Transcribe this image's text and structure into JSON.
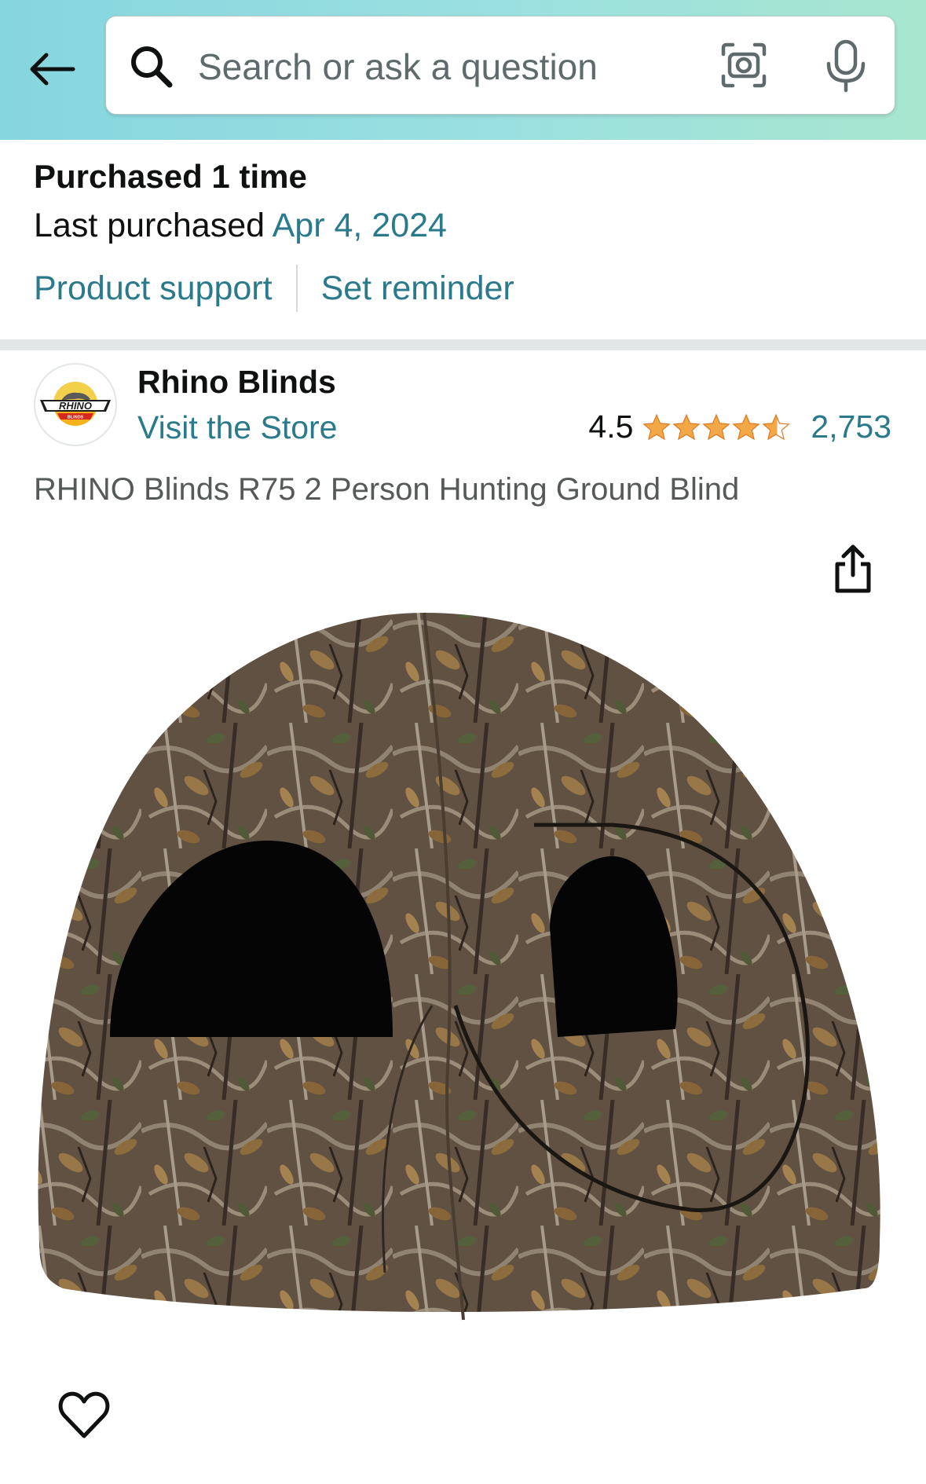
{
  "header": {
    "search_placeholder": "Search or ask a question",
    "colors": {
      "gradient_start": "#86d6df",
      "gradient_end": "#a8e6cf"
    },
    "icons": [
      "back-arrow-icon",
      "search-icon",
      "camera-icon",
      "mic-icon"
    ]
  },
  "purchase": {
    "title": "Purchased 1 time",
    "last_label": "Last purchased",
    "last_date": "Apr 4, 2024",
    "product_support": "Product support",
    "set_reminder": "Set reminder"
  },
  "store": {
    "name": "Rhino Blinds",
    "visit_label": "Visit the Store",
    "logo_text": "RHINO",
    "logo_subtext": "BLINDS",
    "rating": "4.5",
    "rating_value": 4.5,
    "review_count": "2,753"
  },
  "product": {
    "title": "RHINO Blinds R75 2 Person Hunting Ground Blind",
    "image_alt": "camouflage pop-up hunting ground blind"
  },
  "colors": {
    "link": "#2a7a8c",
    "star": "#f3a847",
    "text": "#0f1111",
    "muted": "#565959"
  }
}
